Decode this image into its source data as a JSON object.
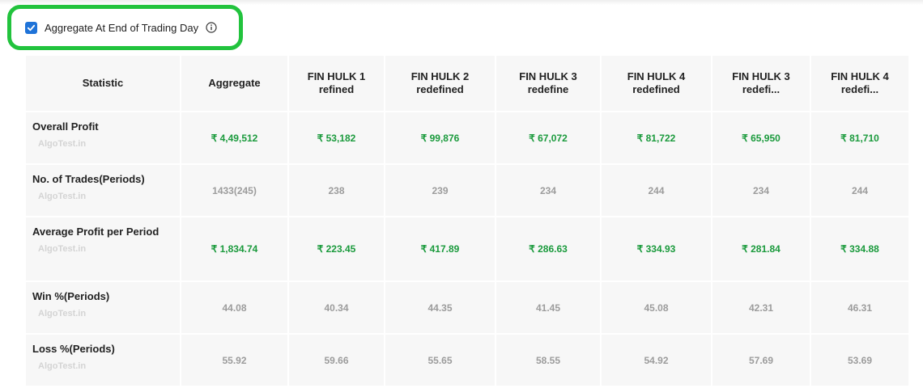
{
  "aggregate_toggle": {
    "label": "Aggregate At End of Trading Day",
    "checked": true,
    "accent_color": "#1f73d8",
    "highlight_color": "#22c33d"
  },
  "table": {
    "headers": [
      "Statistic",
      "Aggregate",
      "FIN HULK 1 refined",
      "FIN HULK 2 redefined",
      "FIN HULK 3 redefine",
      "FIN HULK 4 redefined",
      "FIN HULK 3 redefi...",
      "FIN HULK 4 redefi..."
    ],
    "watermark": "AlgoTest.in",
    "rows": [
      {
        "label": "Overall Profit",
        "values": [
          "₹ 4,49,512",
          "₹ 53,182",
          "₹ 99,876",
          "₹ 67,072",
          "₹ 81,722",
          "₹ 65,950",
          "₹ 81,710"
        ]
      },
      {
        "label": "No. of Trades(Periods)",
        "values": [
          "1433(245)",
          "238",
          "239",
          "234",
          "244",
          "234",
          "244"
        ]
      },
      {
        "label": "Average Profit per Period",
        "values": [
          "₹ 1,834.74",
          "₹ 223.45",
          "₹ 417.89",
          "₹ 286.63",
          "₹ 334.93",
          "₹ 281.84",
          "₹ 334.88"
        ]
      },
      {
        "label": "Win %(Periods)",
        "values": [
          "44.08",
          "40.34",
          "44.35",
          "41.45",
          "45.08",
          "42.31",
          "46.31"
        ]
      },
      {
        "label": "Loss %(Periods)",
        "values": [
          "55.92",
          "59.66",
          "55.65",
          "58.55",
          "54.92",
          "57.69",
          "53.69"
        ]
      }
    ],
    "colors": {
      "positive": "#1a9a3c",
      "neutral": "#9c9c9c"
    }
  }
}
